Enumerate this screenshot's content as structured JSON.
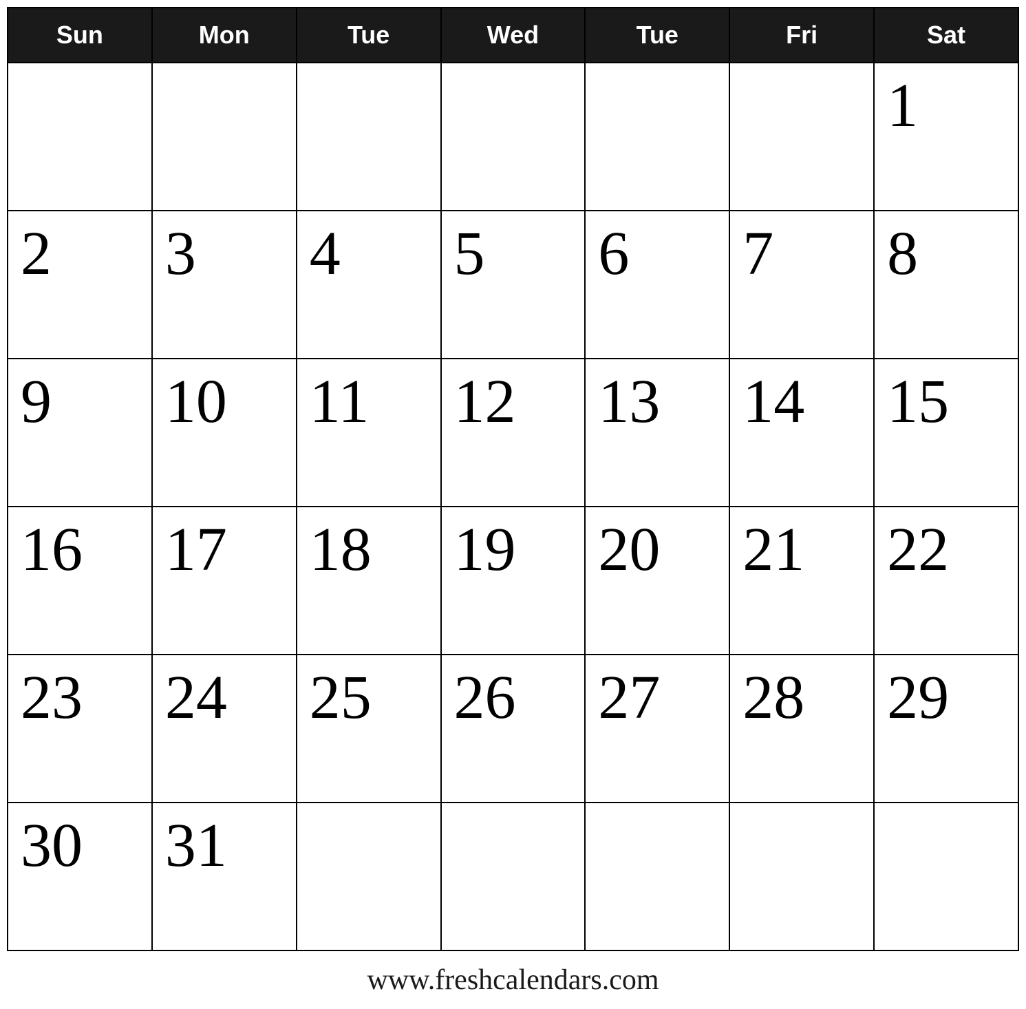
{
  "calendar": {
    "headers": [
      "Sun",
      "Mon",
      "Tue",
      "Wed",
      "Tue",
      "Fri",
      "Sat"
    ],
    "weeks": [
      [
        {
          "day": "",
          "empty": true
        },
        {
          "day": "",
          "empty": true
        },
        {
          "day": "",
          "empty": true
        },
        {
          "day": "",
          "empty": true
        },
        {
          "day": "",
          "empty": true
        },
        {
          "day": "",
          "empty": true
        },
        {
          "day": "1",
          "empty": false
        }
      ],
      [
        {
          "day": "2",
          "empty": false
        },
        {
          "day": "3",
          "empty": false
        },
        {
          "day": "4",
          "empty": false
        },
        {
          "day": "5",
          "empty": false
        },
        {
          "day": "6",
          "empty": false
        },
        {
          "day": "7",
          "empty": false
        },
        {
          "day": "8",
          "empty": false
        }
      ],
      [
        {
          "day": "9",
          "empty": false
        },
        {
          "day": "10",
          "empty": false
        },
        {
          "day": "11",
          "empty": false
        },
        {
          "day": "12",
          "empty": false
        },
        {
          "day": "13",
          "empty": false
        },
        {
          "day": "14",
          "empty": false
        },
        {
          "day": "15",
          "empty": false
        }
      ],
      [
        {
          "day": "16",
          "empty": false
        },
        {
          "day": "17",
          "empty": false
        },
        {
          "day": "18",
          "empty": false
        },
        {
          "day": "19",
          "empty": false
        },
        {
          "day": "20",
          "empty": false
        },
        {
          "day": "21",
          "empty": false
        },
        {
          "day": "22",
          "empty": false
        }
      ],
      [
        {
          "day": "23",
          "empty": false
        },
        {
          "day": "24",
          "empty": false
        },
        {
          "day": "25",
          "empty": false
        },
        {
          "day": "26",
          "empty": false
        },
        {
          "day": "27",
          "empty": false
        },
        {
          "day": "28",
          "empty": false
        },
        {
          "day": "29",
          "empty": false
        }
      ],
      [
        {
          "day": "30",
          "empty": false
        },
        {
          "day": "31",
          "empty": false
        },
        {
          "day": "",
          "empty": true
        },
        {
          "day": "",
          "empty": true
        },
        {
          "day": "",
          "empty": true
        },
        {
          "day": "",
          "empty": true
        },
        {
          "day": "",
          "empty": true
        }
      ]
    ],
    "footer_text": "www.freshcalendars.com"
  }
}
